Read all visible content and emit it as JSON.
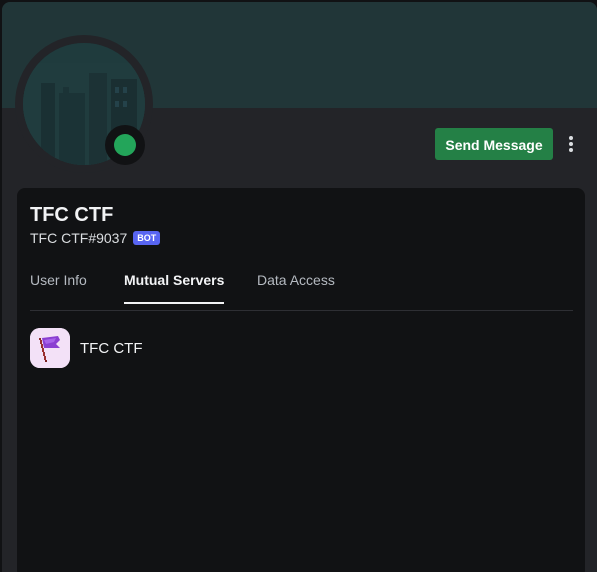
{
  "profile": {
    "display_name": "TFC CTF",
    "tag": "TFC CTF#9037",
    "badge": "BOT",
    "status": "online"
  },
  "actions": {
    "send_message": "Send Message",
    "more_icon": "more-vertical-icon"
  },
  "tabs": [
    {
      "label": "User Info",
      "active": false
    },
    {
      "label": "Mutual Servers",
      "active": true
    },
    {
      "label": "Data Access",
      "active": false
    }
  ],
  "mutual_servers": [
    {
      "name": "TFC CTF",
      "icon": "purple-flag-icon"
    }
  ],
  "colors": {
    "banner": "#213638",
    "status_online": "#23a55a",
    "send_button": "#248046",
    "bot_badge": "#5865f2"
  }
}
